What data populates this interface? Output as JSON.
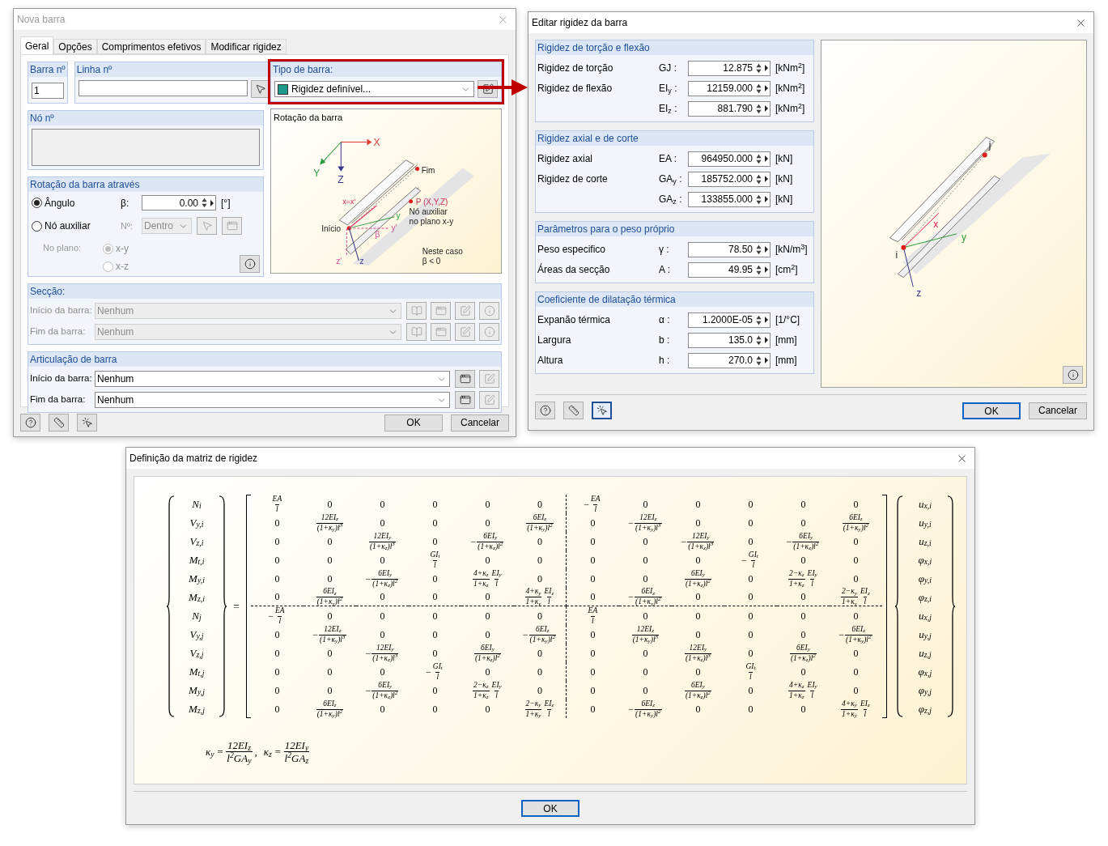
{
  "dialog_new_member": {
    "title": "Nova barra",
    "active": false,
    "tabs": [
      {
        "label": "Geral",
        "selected": true
      },
      {
        "label": "Opções",
        "selected": false
      },
      {
        "label": "Comprimentos efetivos",
        "selected": false
      },
      {
        "label": "Modificar rigidez",
        "selected": false
      }
    ],
    "member_no": {
      "label": "Barra nº",
      "value": "1"
    },
    "line_no": {
      "label": "Linha nº"
    },
    "member_type": {
      "label": "Tipo de barra:",
      "value": "Rigidez definível...",
      "highlighted": true
    },
    "node_no": {
      "label": "Nó nº"
    },
    "rotation": {
      "title": "Rotação da barra através",
      "options": [
        {
          "label": "Ângulo",
          "selected": true
        },
        {
          "label": "Nó auxiliar",
          "selected": false
        }
      ],
      "beta_label": "β:",
      "beta_value": "0.00",
      "beta_unit": "[°]",
      "node_label": "Nº:",
      "node_value": "Dentro",
      "plane_label": "No plano:",
      "planes": [
        {
          "label": "x-y",
          "selected": true
        },
        {
          "label": "x-z",
          "selected": false
        }
      ]
    },
    "diagram": {
      "title": "Rotação da barra",
      "axis_X": "X",
      "axis_Y": "Y",
      "axis_Z": "Z",
      "end": "Fim",
      "point": "P (X,Y,Z)",
      "aux_1": "Nó auxiliar",
      "aux_2": "no plano x-y",
      "start": "Início",
      "local_x": "x=x'",
      "local_y": "y",
      "local_y2": "y'",
      "beta": "β",
      "local_z2": "z'",
      "local_z": "z",
      "note_1": "Neste caso",
      "note_2": "β < 0"
    },
    "section": {
      "title": "Secção:",
      "disabled": true,
      "rows": [
        {
          "label": "Início da barra:",
          "value": "Nenhum"
        },
        {
          "label": "Fim da barra:",
          "value": "Nenhum"
        }
      ]
    },
    "hinge": {
      "title": "Articulação de barra",
      "disabled": false,
      "rows": [
        {
          "label": "Início da barra:",
          "value": "Nenhum"
        },
        {
          "label": "Fim da barra:",
          "value": "Nenhum"
        }
      ]
    },
    "tools": [
      {
        "selected": false
      },
      {
        "selected": false
      },
      {
        "selected": false
      }
    ],
    "buttons": [
      {
        "label": "OK",
        "default": false
      },
      {
        "label": "Cancelar",
        "default": false
      }
    ]
  },
  "dialog_stiffness": {
    "title": "Editar rigidez da barra",
    "active": true,
    "groups": [
      {
        "title": "Rigidez de torção e flexão",
        "rows": [
          {
            "label": "Rigidez de torção",
            "symbol": "GJ :",
            "value": "12.875",
            "unit": "[kNm$^{2}$]"
          },
          {
            "label": "Rigidez de flexão",
            "symbol": "EI$_{y}$ :",
            "value": "12159.000",
            "unit": "[kNm$^{2}$]"
          },
          {
            "symbol": "EI$_{z}$ :",
            "value": "881.790",
            "unit": "[kNm$^{2}$]"
          }
        ]
      },
      {
        "title": "Rigidez axial e de corte",
        "rows": [
          {
            "label": "Rigidez axial",
            "symbol": "EA :",
            "value": "964950.000",
            "unit": "[kN]"
          },
          {
            "label": "Rigidez de corte",
            "symbol": "GA$_{y}$ :",
            "value": "185752.000",
            "unit": "[kN]"
          },
          {
            "symbol": "GA$_{z}$ :",
            "value": "133855.000",
            "unit": "[kN]"
          }
        ]
      },
      {
        "title": "Parâmetros para o peso próprio",
        "rows": [
          {
            "label": "Peso especifico",
            "symbol": "γ :",
            "value": "78.50",
            "unit": "[kN/m$^{3}$]"
          },
          {
            "label": "Áreas da secção",
            "symbol": "A :",
            "value": "49.95",
            "unit": "[cm$^{2}$]"
          }
        ]
      },
      {
        "title": "Coeficiente de dilatação térmica",
        "rows": [
          {
            "label": "Expanão térmica",
            "symbol": "α :",
            "value": "1.2000E-05",
            "unit": "[1/°C]"
          },
          {
            "label": "Largura",
            "symbol": "b :",
            "value": "135.0",
            "unit": "[mm]"
          },
          {
            "label": "Altura",
            "symbol": "h :",
            "value": "270.0",
            "unit": "[mm]"
          }
        ]
      }
    ],
    "diagram": {
      "node_j": "j",
      "node_i": "i",
      "axis_x": "x",
      "axis_y": "y",
      "axis_z": "z"
    },
    "tools": [
      {
        "selected": false
      },
      {
        "selected": false
      },
      {
        "selected": true
      }
    ],
    "buttons": [
      {
        "label": "OK",
        "default": true
      },
      {
        "label": "Cancelar",
        "default": false
      }
    ]
  },
  "dialog_matrix": {
    "title": "Definição da matriz de rigidez",
    "active": true,
    "forces": [
      "N$_{i}$",
      "V$_{y,i}$",
      "V$_{z,i}$",
      "M$_{t,i}$",
      "M$_{y,i}$",
      "M$_{z,i}$",
      "N$_{j}$",
      "V$_{y,j}$",
      "V$_{z,j}$",
      "M$_{t,j}$",
      "M$_{y,j}$",
      "M$_{z,j}$"
    ],
    "equals": "=",
    "matrix": [
      [
        {
          "num": "EA",
          "den": "l"
        },
        "0",
        "0",
        "0",
        "0",
        "0",
        {
          "sign": "−",
          "num": "EA",
          "den": "l"
        },
        "0",
        "0",
        "0",
        "0",
        "0"
      ],
      [
        "0",
        {
          "num": "12EI$_{z}$",
          "den": "(1+κ$_{y}$)l$^{3}$"
        },
        "0",
        "0",
        "0",
        {
          "num": "6EI$_{z}$",
          "den": "(1+κ$_{y}$)l$^{2}$"
        },
        "0",
        {
          "sign": "−",
          "num": "12EI$_{z}$",
          "den": "(1+κ$_{y}$)l$^{3}$"
        },
        "0",
        "0",
        "0",
        {
          "num": "6EI$_{z}$",
          "den": "(1+κ$_{y}$)l$^{2}$"
        }
      ],
      [
        "0",
        "0",
        {
          "num": "12EI$_{y}$",
          "den": "(1+κ$_{z}$)l$^{3}$"
        },
        "0",
        {
          "sign": "−",
          "num": "6EI$_{y}$",
          "den": "(1+κ$_{z}$)l$^{2}$"
        },
        "0",
        "0",
        "0",
        {
          "sign": "−",
          "num": "12EI$_{y}$",
          "den": "(1+κ$_{z}$)l$^{3}$"
        },
        "0",
        {
          "sign": "−",
          "num": "6EI$_{y}$",
          "den": "(1+κ$_{z}$)l$^{2}$"
        },
        "0"
      ],
      [
        "0",
        "0",
        "0",
        {
          "num": "GI$_{t}$",
          "den": "l"
        },
        "0",
        "0",
        "0",
        "0",
        "0",
        {
          "sign": "−",
          "num": "GI$_{t}$",
          "den": "l"
        },
        "0",
        "0"
      ],
      [
        "0",
        "0",
        {
          "sign": "−",
          "num": "6EI$_{y}$",
          "den": "(1+κ$_{z}$)l$^{2}$"
        },
        "0",
        {
          "num": "4+κ$_{z}$",
          "den": "1+κ$_{z}$",
          "num2": "EI$_{y}$",
          "den2": "l"
        },
        "0",
        "0",
        "0",
        {
          "num": "6EI$_{y}$",
          "den": "(1+κ$_{z}$)l$^{2}$"
        },
        "0",
        {
          "num": "2−κ$_{z}$",
          "den": "1+κ$_{z}$",
          "num2": "EI$_{y}$",
          "den2": "l"
        },
        "0"
      ],
      [
        "0",
        {
          "num": "6EI$_{z}$",
          "den": "(1+κ$_{y}$)l$^{2}$"
        },
        "0",
        "0",
        "0",
        {
          "num": "4+κ$_{y}$",
          "den": "1+κ$_{y}$",
          "num2": "EI$_{z}$",
          "den2": "l"
        },
        "0",
        {
          "sign": "−",
          "num": "6EI$_{z}$",
          "den": "(1+κ$_{y}$)l$^{2}$"
        },
        "0",
        "0",
        "0",
        {
          "num": "2−κ$_{y}$",
          "den": "1+κ$_{y}$",
          "num2": "EI$_{z}$",
          "den2": "l"
        }
      ],
      [
        {
          "sign": "−",
          "num": "EA",
          "den": "l"
        },
        "0",
        "0",
        "0",
        "0",
        "0",
        {
          "num": "EA",
          "den": "l"
        },
        "0",
        "0",
        "0",
        "0",
        "0"
      ],
      [
        "0",
        {
          "sign": "−",
          "num": "12EI$_{z}$",
          "den": "(1+κ$_{y}$)l$^{3}$"
        },
        "0",
        "0",
        "0",
        {
          "sign": "−",
          "num": "6EI$_{z}$",
          "den": "(1+κ$_{y}$)l$^{2}$"
        },
        "0",
        {
          "num": "12EI$_{z}$",
          "den": "(1+κ$_{y}$)l$^{3}$"
        },
        "0",
        "0",
        "0",
        {
          "sign": "−",
          "num": "6EI$_{z}$",
          "den": "(1+κ$_{y}$)l$^{2}$"
        }
      ],
      [
        "0",
        "0",
        {
          "sign": "−",
          "num": "12EI$_{y}$",
          "den": "(1+κ$_{z}$)l$^{3}$"
        },
        "0",
        {
          "num": "6EI$_{y}$",
          "den": "(1+κ$_{z}$)l$^{2}$"
        },
        "0",
        "0",
        "0",
        {
          "num": "12EI$_{y}$",
          "den": "(1+κ$_{z}$)l$^{3}$"
        },
        "0",
        {
          "num": "6EI$_{y}$",
          "den": "(1+κ$_{z}$)l$^{2}$"
        },
        "0"
      ],
      [
        "0",
        "0",
        "0",
        {
          "sign": "−",
          "num": "GI$_{t}$",
          "den": "l"
        },
        "0",
        "0",
        "0",
        "0",
        "0",
        {
          "num": "GI$_{t}$",
          "den": "l"
        },
        "0",
        "0"
      ],
      [
        "0",
        "0",
        {
          "sign": "−",
          "num": "6EI$_{y}$",
          "den": "(1+κ$_{z}$)l$^{2}$"
        },
        "0",
        {
          "num": "2−κ$_{z}$",
          "den": "1+κ$_{z}$",
          "num2": "EI$_{y}$",
          "den2": "l"
        },
        "0",
        "0",
        "0",
        {
          "num": "6EI$_{y}$",
          "den": "(1+κ$_{z}$)l$^{2}$"
        },
        "0",
        {
          "num": "4+κ$_{z}$",
          "den": "1+κ$_{z}$",
          "num2": "EI$_{y}$",
          "den2": "l"
        },
        "0"
      ],
      [
        "0",
        {
          "num": "6EI$_{z}$",
          "den": "(1+κ$_{y}$)l$^{2}$"
        },
        "0",
        "0",
        "0",
        {
          "num": "2−κ$_{y}$",
          "den": "1+κ$_{y}$",
          "num2": "EI$_{z}$",
          "den2": "l"
        },
        "0",
        {
          "sign": "−",
          "num": "6EI$_{z}$",
          "den": "(1+κ$_{y}$)l$^{2}$"
        },
        "0",
        "0",
        "0",
        {
          "num": "4+κ$_{y}$",
          "den": "1+κ$_{y}$",
          "num2": "EI$_{z}$",
          "den2": "l"
        }
      ]
    ],
    "displacements": [
      "u$_{x,i}$",
      "u$_{y,i}$",
      "u$_{z,i}$",
      "φ$_{x,i}$",
      "φ$_{y,i}$",
      "φ$_{z,i}$",
      "u$_{x,j}$",
      "u$_{y,j}$",
      "u$_{z,j}$",
      "φ$_{x,j}$",
      "φ$_{y,j}$",
      "φ$_{z,j}$"
    ],
    "definitions": [
      {
        "lhs": "κ$_{y}$",
        "eq": "=",
        "num": "12EI$_{z}$",
        "den": "l$^{2}$GA$_{y}$",
        "after": ","
      },
      {
        "lhs": "κ$_{z}$",
        "eq": "=",
        "num": "12EI$_{y}$",
        "den": "l$^{2}$GA$_{z}$"
      }
    ],
    "buttons": [
      {
        "label": "OK",
        "default": true
      }
    ]
  }
}
